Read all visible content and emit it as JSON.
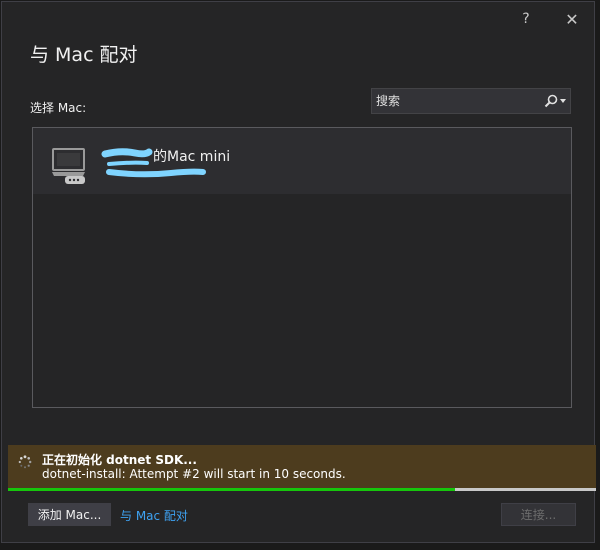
{
  "dialog": {
    "title": "与 Mac 配对",
    "help_label": "?",
    "close_label": "✕"
  },
  "mac_select": {
    "label": "选择 Mac:"
  },
  "search": {
    "placeholder": "搜索"
  },
  "mac_list": {
    "items": [
      {
        "name": "的Mac mini",
        "icon": "mac-mini-icon"
      }
    ]
  },
  "status": {
    "title": "正在初始化 dotnet SDK...",
    "detail": "dotnet-install: Attempt #2 will start in 10 seconds.",
    "progress": 0.76,
    "progress_color": "#16c60c",
    "banner_color": "#4d3c1e"
  },
  "footer": {
    "add_mac_label": "添加 Mac...",
    "pair_link_label": "与 Mac 配对",
    "connect_label": "连接..."
  },
  "colors": {
    "accent_link": "#3ea2f2",
    "background": "#252526"
  }
}
